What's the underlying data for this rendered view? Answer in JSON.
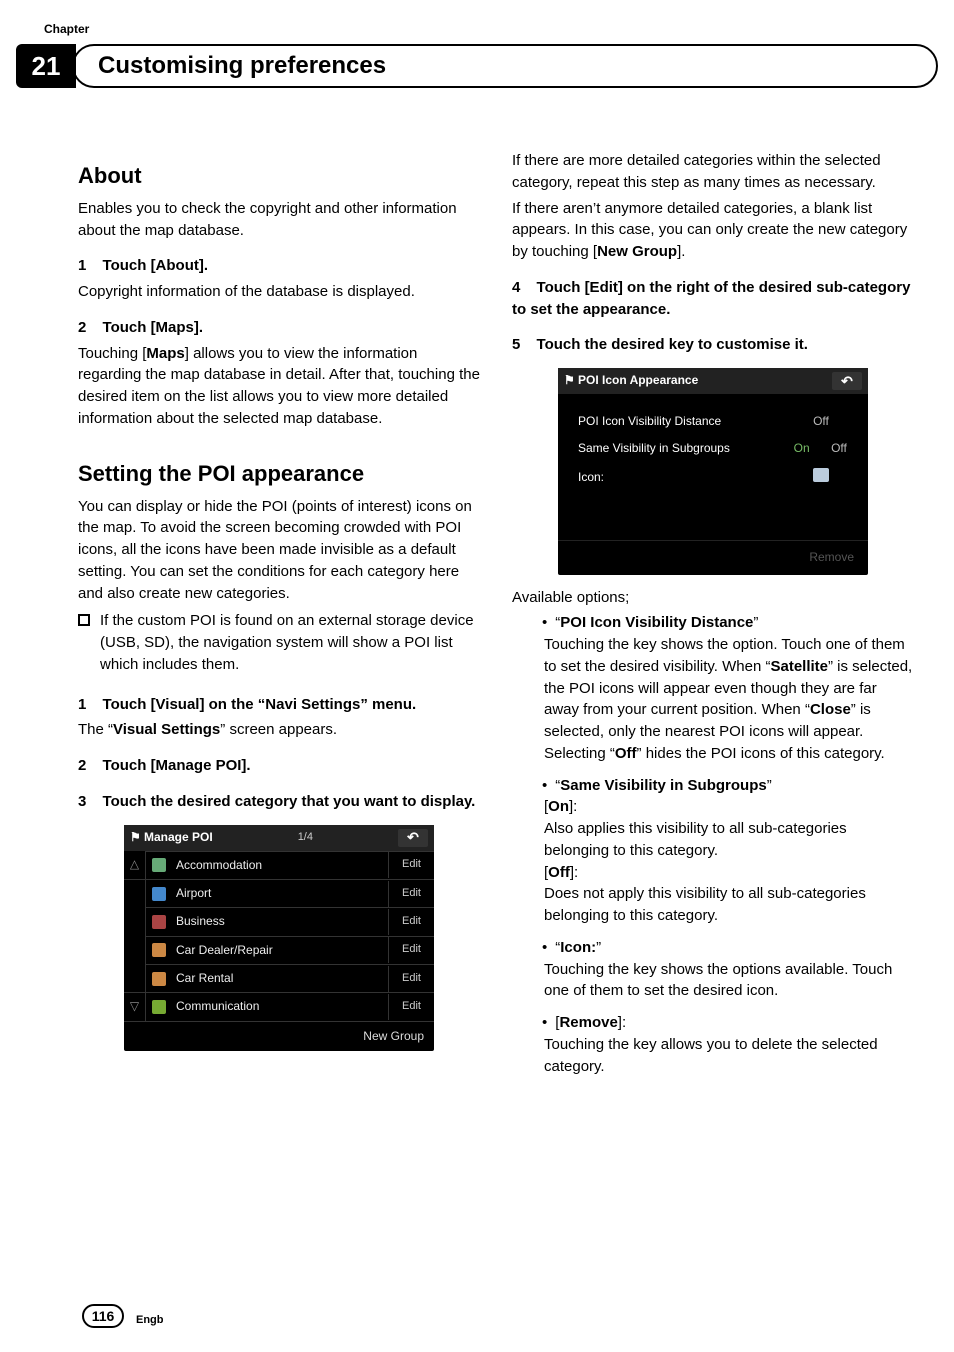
{
  "header": {
    "chapter_label": "Chapter",
    "chapter_number": "21",
    "title": "Customising preferences"
  },
  "left": {
    "about_heading": "About",
    "about_p1": "Enables you to check the copyright and other information about the map database.",
    "step1_label": "1",
    "step1_title": "Touch [About].",
    "step1_body": "Copyright information of the database is displayed.",
    "step2_label": "2",
    "step2_title": "Touch [Maps].",
    "step2_body_a": "Touching [",
    "step2_body_bold": "Maps",
    "step2_body_b": "] allows you to view the information regarding the map database in detail. After that, touching the desired item on the list allows you to view more detailed information about the selected map database.",
    "poi_heading": "Setting the POI appearance",
    "poi_body": "You can display or hide the POI (points of interest) icons on the map. To avoid the screen becoming crowded with POI icons, all the icons have been made invisible as a default setting. You can set the conditions for each category here and also create new categories.",
    "poi_bullet": "If the custom POI is found on an external storage device (USB, SD), the navigation system will show a POI list which includes them.",
    "s1_label": "1",
    "s1_title": "Touch [Visual] on the “Navi Settings” menu.",
    "s1_body_a": "The “",
    "s1_body_bold": "Visual Settings",
    "s1_body_b": "” screen appears.",
    "s2_label": "2",
    "s2_title": "Touch [Manage POI].",
    "s3_label": "3",
    "s3_title": "Touch the desired category that you want to display.",
    "manage_poi": {
      "title": "Manage POI",
      "pager": "1/4",
      "rows": [
        {
          "label": "Accommodation",
          "edit": "Edit"
        },
        {
          "label": "Airport",
          "edit": "Edit"
        },
        {
          "label": "Business",
          "edit": "Edit"
        },
        {
          "label": "Car Dealer/Repair",
          "edit": "Edit"
        },
        {
          "label": "Car Rental",
          "edit": "Edit"
        },
        {
          "label": "Communication",
          "edit": "Edit"
        }
      ],
      "footer": "New Group"
    }
  },
  "right": {
    "p1_a": "If there are more detailed categories within the selected category, repeat this step as many times as necessary.",
    "p1_b_a": "If there aren’t anymore detailed categories, a blank list appears. In this case, you can only create the new category by touching [",
    "p1_b_bold": "New Group",
    "p1_b_b": "].",
    "s4_label": "4",
    "s4_title": "Touch [Edit] on the right of the desired sub-category to set the appearance.",
    "s5_label": "5",
    "s5_title": "Touch the desired key to customise it.",
    "appearance": {
      "title": "POI Icon Appearance",
      "rows": {
        "r1_label": "POI Icon Visibility Distance",
        "r1_val": "Off",
        "r2_label": "Same Visibility in Subgroups",
        "r2_on": "On",
        "r2_off": "Off",
        "r3_label": "Icon:"
      },
      "footer": "Remove"
    },
    "available_label": "Available options;",
    "opt1_title": "POI Icon Visibility Distance",
    "opt1_body_a": "Touching the key shows the option. Touch one of them to set the desired visibility. When “",
    "opt1_bold1": "Satellite",
    "opt1_body_b": "” is selected, the POI icons will appear even though they are far away from your current position. When “",
    "opt1_bold2": "Close",
    "opt1_body_c": "” is selected, only the nearest POI icons will appear. Selecting “",
    "opt1_bold3": "Off",
    "opt1_body_d": "” hides the POI icons of this category.",
    "opt2_title": "Same Visibility in Subgroups",
    "opt2_on_label": "On",
    "opt2_on_body": "Also applies this visibility to all sub-categories belonging to this category.",
    "opt2_off_label": "Off",
    "opt2_off_body": "Does not apply this visibility to all sub-categories belonging to this category.",
    "opt3_title": "Icon:",
    "opt3_body": "Touching the key shows the options available. Touch one of them to set the desired icon.",
    "opt4_title": "Remove",
    "opt4_body": "Touching the key allows you to delete the selected category."
  },
  "footer": {
    "page": "116",
    "lang": "Engb"
  }
}
